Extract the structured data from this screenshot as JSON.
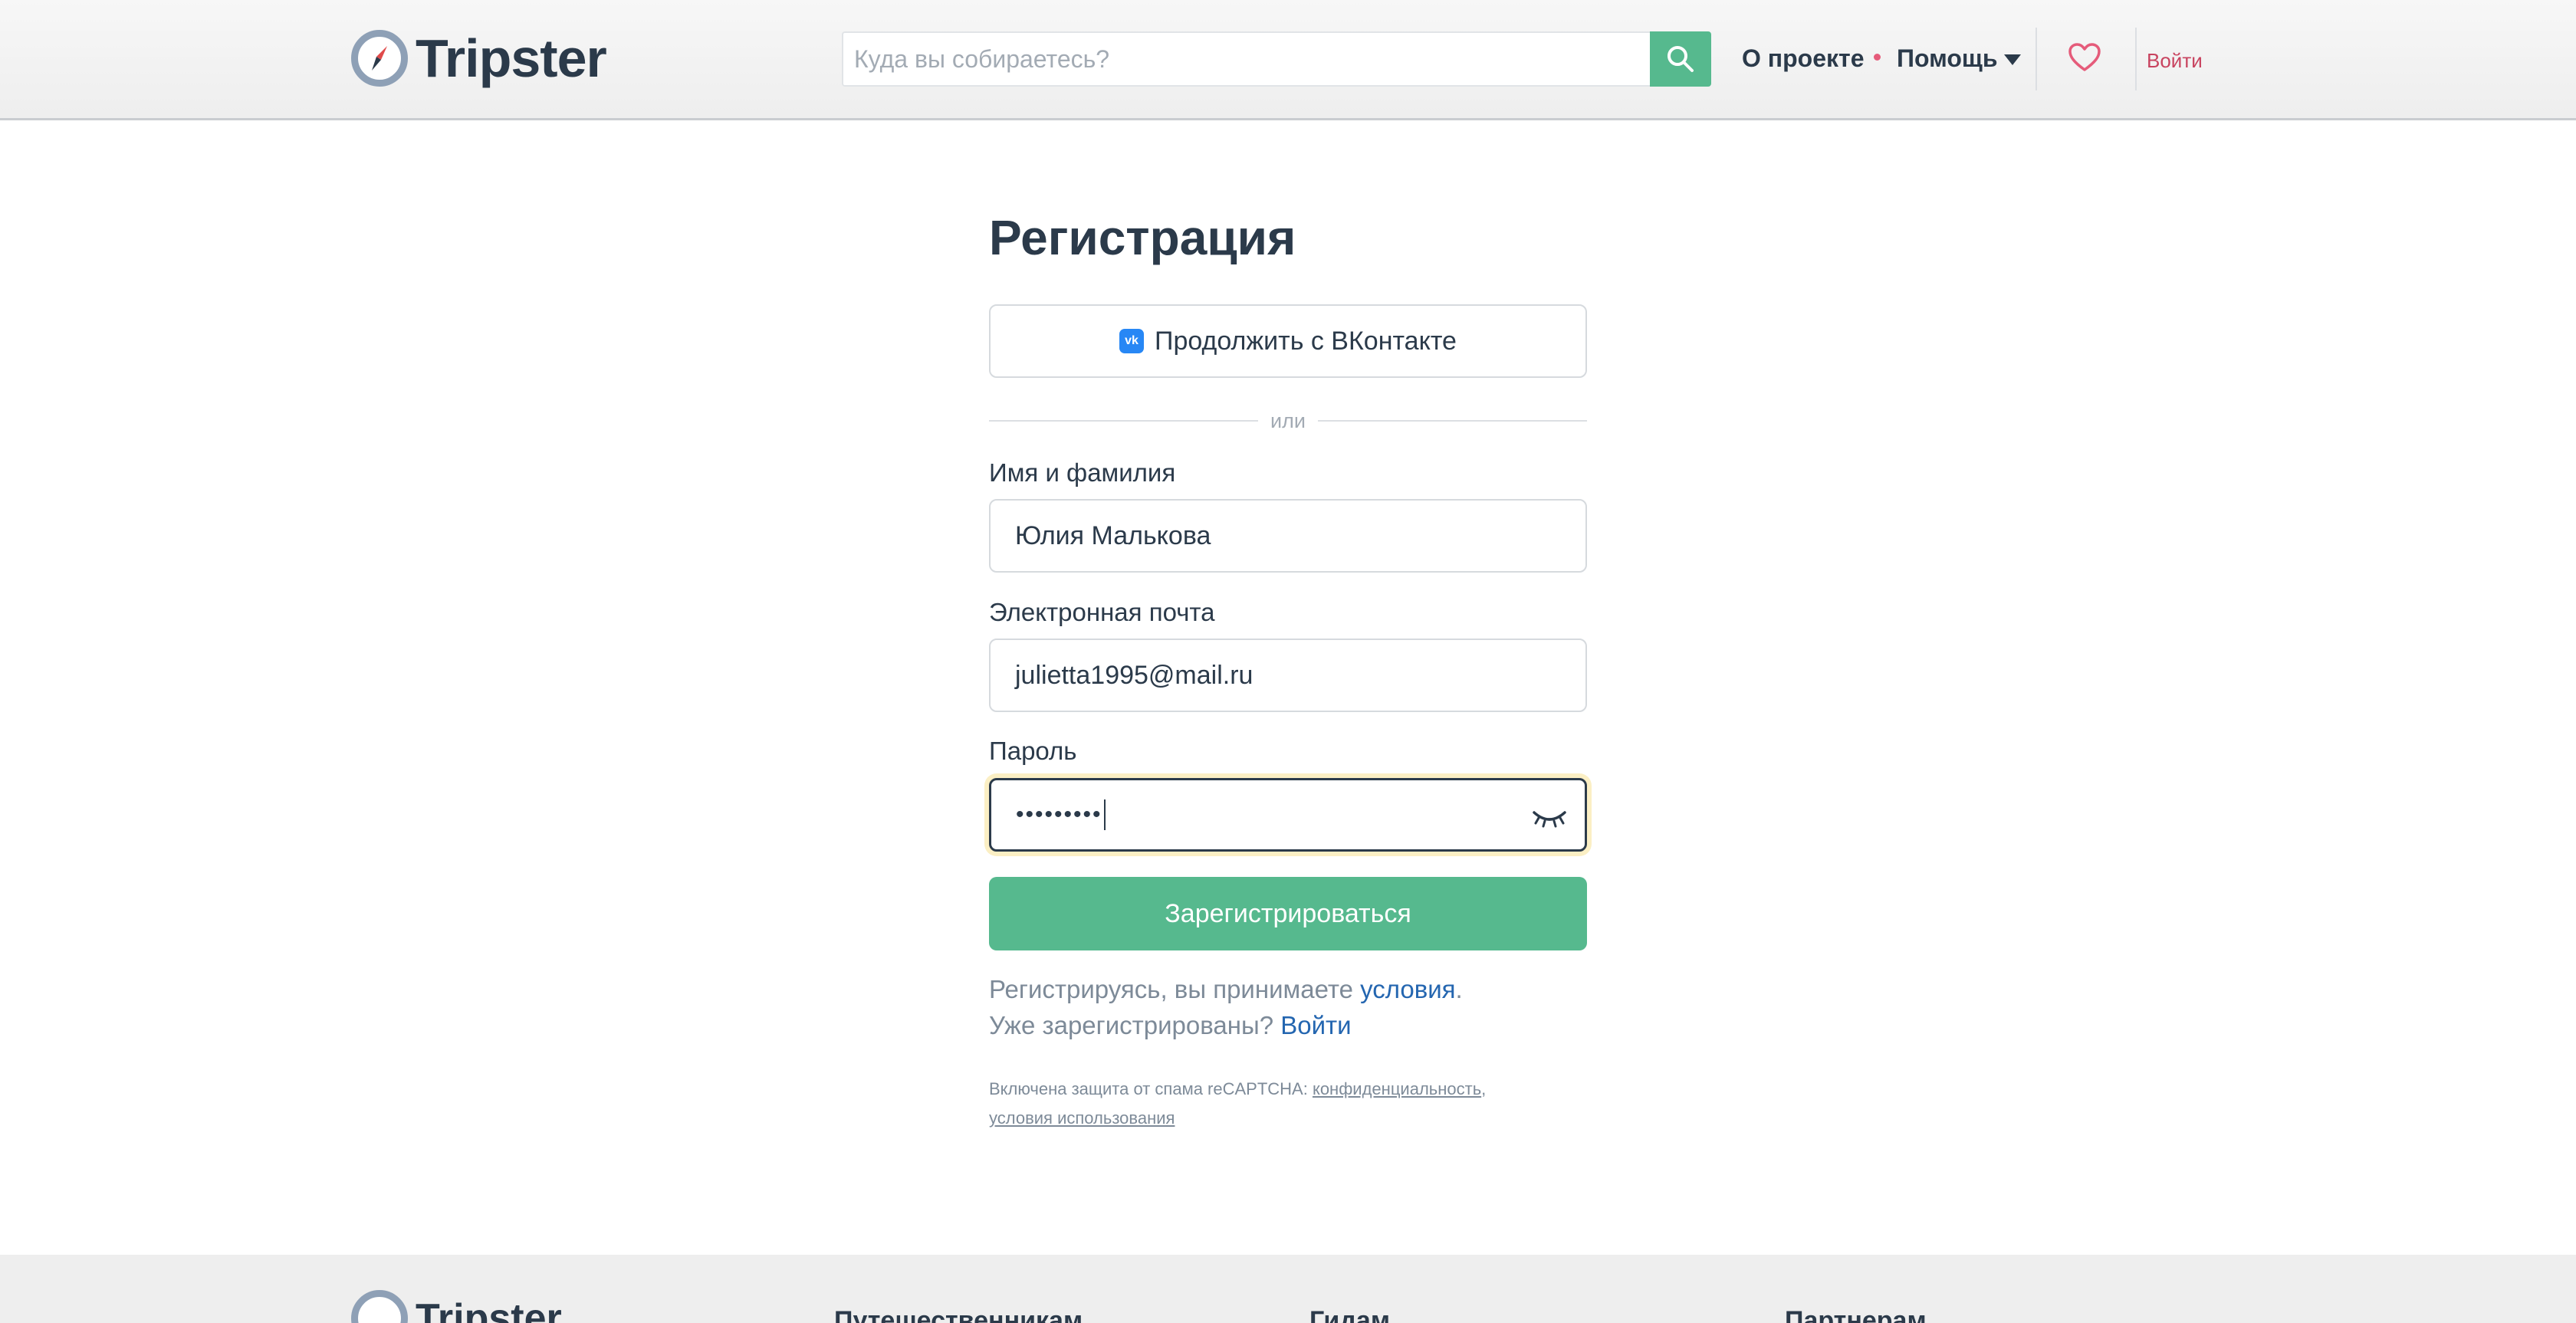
{
  "header": {
    "logo_text": "Tripster",
    "search": {
      "placeholder": "Куда вы собираетесь?",
      "value": ""
    },
    "nav": {
      "about": "О проекте",
      "help": "Помощь"
    },
    "login": "Войти"
  },
  "form": {
    "title": "Регистрация",
    "vk_button": "Продолжить с ВКонтакте",
    "vk_icon_text": "vk",
    "divider": "или",
    "name": {
      "label": "Имя и фамилия",
      "value": "Юлия Малькова"
    },
    "email": {
      "label": "Электронная почта",
      "value": "julietta1995@mail.ru"
    },
    "password": {
      "label": "Пароль",
      "value": "•••••••••"
    },
    "submit": "Зарегистрироваться",
    "terms": {
      "prefix": "Регистрируясь, вы принимаете ",
      "link": "условия",
      "suffix": ".",
      "have_account": "Уже зарегистрированы? ",
      "login_link": "Войти"
    },
    "recaptcha": {
      "prefix": "Включена защита от спама reCAPTCHA: ",
      "privacy": "конфиденциальность",
      "separator": ",",
      "terms": "условия использования"
    }
  },
  "footer": {
    "logo_text": "Tripster",
    "columns": [
      "Путешественникам",
      "Гидам",
      "Партнерам"
    ]
  },
  "colors": {
    "accent": "#56b98e",
    "text": "#2b3a4a",
    "link": "#2466b0",
    "login": "#c8435f",
    "heart": "#e55b7a",
    "vk": "#2787f5"
  },
  "icons": {
    "logo": "compass-icon",
    "search": "search-icon",
    "help_dropdown": "caret-down-icon",
    "favorites": "heart-icon",
    "vk": "vk-icon",
    "password_toggle": "eye-closed-icon"
  }
}
